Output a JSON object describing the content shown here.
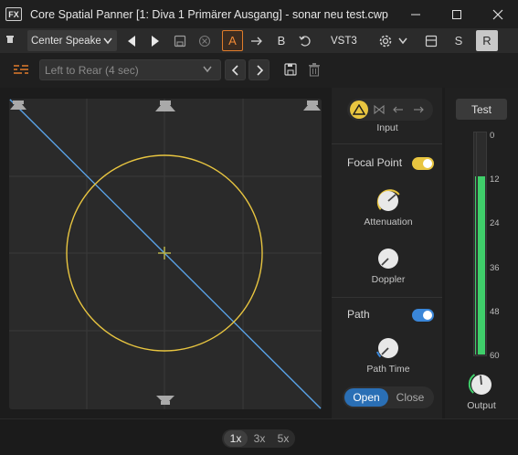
{
  "window": {
    "app_icon": "FX",
    "title": "Core Spatial Panner [1: Diva 1 Primärer Ausgang] - sonar neu test.cwp"
  },
  "toolbar": {
    "preset": "Center Speaker",
    "ab_a": "A",
    "ab_b": "B",
    "plugin_format": "VST3",
    "s_label": "S",
    "r_label": "R"
  },
  "path_toolbar": {
    "path_preset": "Left to Rear (4 sec)"
  },
  "right_panel": {
    "input_label": "Input",
    "focal_point_label": "Focal Point",
    "attenuation_label": "Attenuation",
    "doppler_label": "Doppler",
    "path_label": "Path",
    "path_time_label": "Path Time",
    "open_label": "Open",
    "close_label": "Close",
    "focal_point_enabled": true,
    "path_enabled": true
  },
  "meter": {
    "test_label": "Test",
    "scale": [
      "0",
      "12",
      "24",
      "36",
      "48",
      "60"
    ],
    "output_label": "Output",
    "left_level": 0.8,
    "right_level": 0.8
  },
  "zoom": {
    "options": [
      "1x",
      "3x",
      "5x"
    ],
    "selected": "1x"
  },
  "colors": {
    "accent_yellow": "#e8c540",
    "path_blue": "#5aa3e8",
    "meter_green": "#3fcf6a",
    "toggle_blue": "#3a86d8",
    "ab_orange": "#f08a35"
  }
}
